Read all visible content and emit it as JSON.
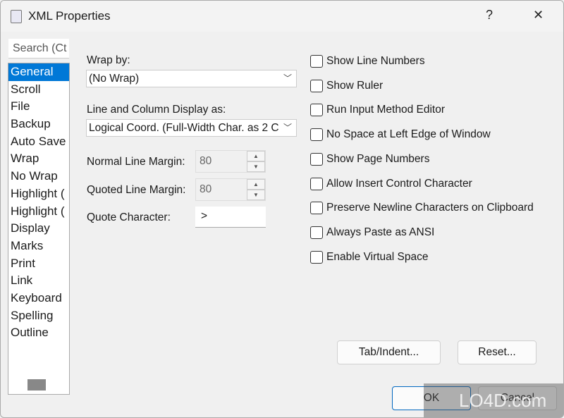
{
  "window": {
    "title": "XML Properties",
    "help": "?",
    "close": "✕"
  },
  "sidebar": {
    "search_placeholder": "Search (Ct",
    "items": [
      "General",
      "Scroll",
      "File",
      "Backup",
      "Auto Save",
      "Wrap",
      "No Wrap",
      "Highlight (",
      "Highlight (",
      "Display",
      "Marks",
      "Print",
      "Link",
      "Keyboard",
      "Spelling",
      "Outline"
    ],
    "selected": "General"
  },
  "form": {
    "wrap_by_label": "Wrap by:",
    "wrap_by_value": "(No Wrap)",
    "display_label": "Line and Column Display as:",
    "display_value": "Logical Coord. (Full-Width Char. as 2 C",
    "normal_margin_label": "Normal Line Margin:",
    "normal_margin_value": "80",
    "quoted_margin_label": "Quoted Line Margin:",
    "quoted_margin_value": "80",
    "quote_char_label": "Quote Character:",
    "quote_char_value": ">"
  },
  "checkboxes": [
    {
      "label": "Show Line Numbers",
      "checked": false
    },
    {
      "label": "Show Ruler",
      "checked": false
    },
    {
      "label": "Run Input Method Editor",
      "checked": false
    },
    {
      "label": "No Space at Left Edge of Window",
      "checked": false
    },
    {
      "label": "Show Page Numbers",
      "checked": false
    },
    {
      "label": "Allow Insert Control Character",
      "checked": false
    },
    {
      "label": "Preserve Newline Characters on Clipboard",
      "checked": false
    },
    {
      "label": "Always Paste as ANSI",
      "checked": false
    },
    {
      "label": "Enable Virtual Space",
      "checked": false
    }
  ],
  "buttons": {
    "tab_indent": "Tab/Indent...",
    "reset": "Reset...",
    "ok": "OK",
    "cancel": "Cancel"
  },
  "watermark": "LO4D.com",
  "colors": {
    "accent": "#0078d7"
  }
}
